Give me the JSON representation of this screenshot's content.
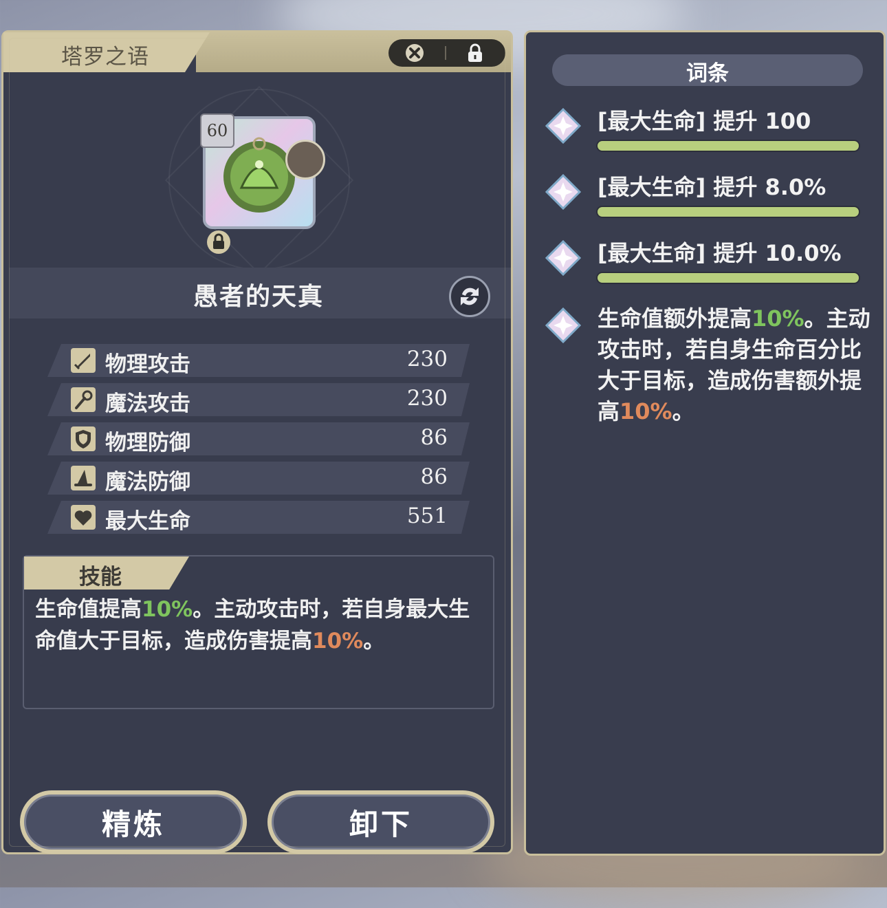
{
  "equipment_panel": {
    "tab_title": "塔罗之语",
    "item_level": "60",
    "item_name": "愚者的天真",
    "stats": [
      {
        "label": "物理攻击",
        "value": "230",
        "icon": "sword-icon"
      },
      {
        "label": "魔法攻击",
        "value": "230",
        "icon": "staff-icon"
      },
      {
        "label": "物理防御",
        "value": "86",
        "icon": "shield-icon"
      },
      {
        "label": "魔法防御",
        "value": "86",
        "icon": "wizard-hat-icon"
      },
      {
        "label": "最大生命",
        "value": "551",
        "icon": "heart-icon"
      }
    ],
    "skill": {
      "title": "技能",
      "text_part1": "生命值提高",
      "value1": "10%",
      "text_part2": "。主动攻击时，若自身最大生命值大于目标，造成伤害提高",
      "value2": "10%",
      "text_part3": "。"
    },
    "buttons": {
      "refine": "精炼",
      "unequip": "卸下"
    }
  },
  "affix_panel": {
    "title": "词条",
    "affixes": [
      {
        "text": "[最大生命] 提升 100"
      },
      {
        "text": "[最大生命] 提升 8.0%"
      },
      {
        "text": "[最大生命] 提升 10.0%"
      }
    ],
    "special": {
      "text_part1": "生命值额外提高",
      "value1": "10%",
      "text_part2": "。主动攻击时，若自身生命百分比大于目标，造成伤害额外提高",
      "value2": "10%",
      "text_part3": "。"
    }
  },
  "colors": {
    "panel_bg": "#383c4d",
    "gold_trim": "#c9bf9c",
    "green_value": "#7fc45e",
    "orange_value": "#e08a5c",
    "affix_bar": "#b8cf7e"
  }
}
